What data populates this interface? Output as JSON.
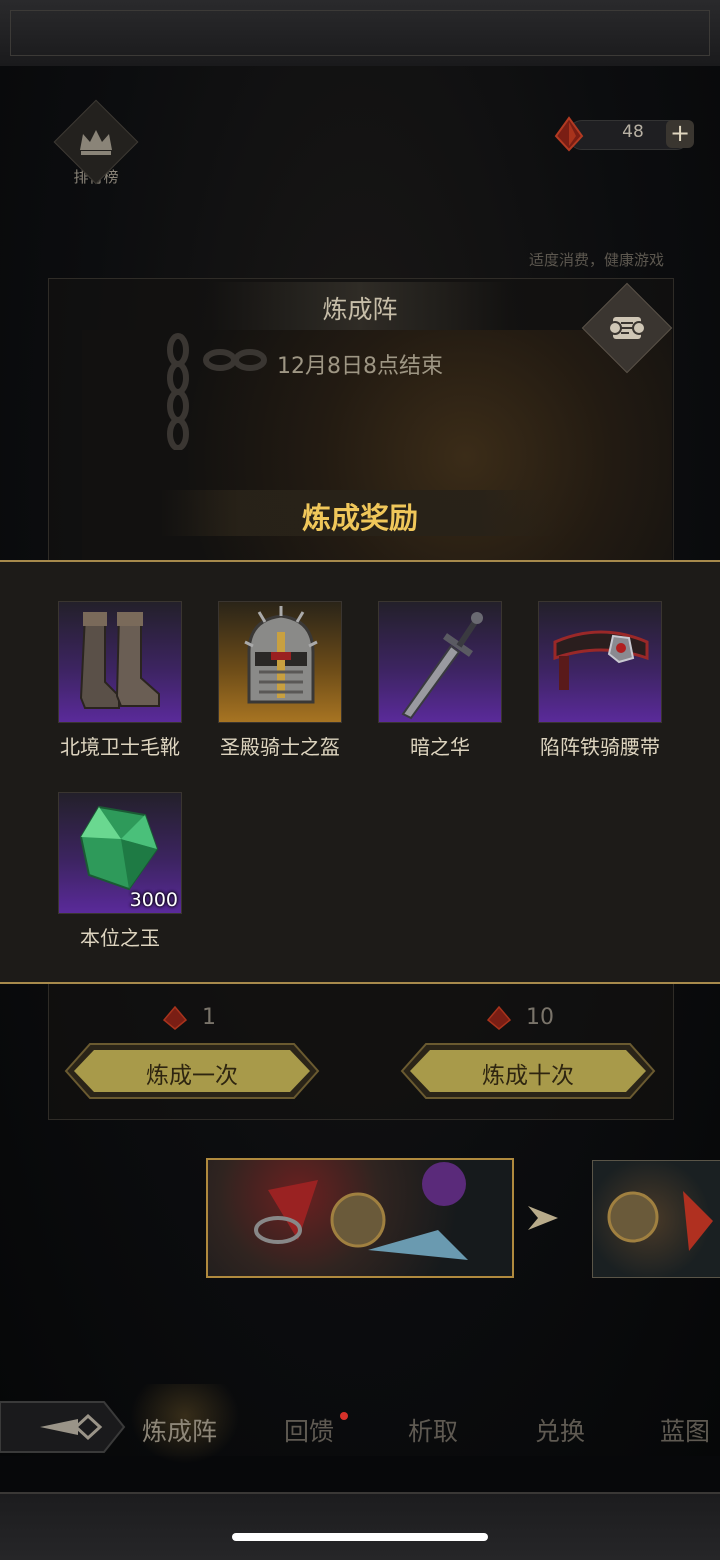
{
  "header": {
    "ranking_label": "排行榜",
    "currency_amount": "48",
    "add_label": "+",
    "health_notice": "适度消费，健康游戏"
  },
  "panel": {
    "title": "炼成阵",
    "end_time": "12月8日8点结束",
    "reward_title": "炼成奖励"
  },
  "rewards": [
    {
      "name": "北境卫士毛靴",
      "rarity": "epic",
      "icon": "boots-icon"
    },
    {
      "name": "圣殿骑士之盔",
      "rarity": "legendary",
      "icon": "helmet-icon"
    },
    {
      "name": "暗之华",
      "rarity": "epic",
      "icon": "sword-icon"
    },
    {
      "name": "陷阵铁骑腰带",
      "rarity": "epic",
      "icon": "belt-icon"
    },
    {
      "name": "本位之玉",
      "rarity": "epic",
      "icon": "green-gem-icon",
      "quantity": "3000"
    }
  ],
  "actions": {
    "single": {
      "cost": "1",
      "label": "炼成一次"
    },
    "ten": {
      "cost": "10",
      "label": "炼成十次"
    }
  },
  "tabs": [
    {
      "label": "炼成阵",
      "active": true
    },
    {
      "label": "回馈",
      "badge": true
    },
    {
      "label": "析取"
    },
    {
      "label": "兑换"
    },
    {
      "label": "蓝图"
    }
  ],
  "colors": {
    "accent_gold": "#f0c75a",
    "epic_purple": "#5a2a9a",
    "legendary_orange": "#a77422",
    "badge_red": "#d6312a"
  }
}
